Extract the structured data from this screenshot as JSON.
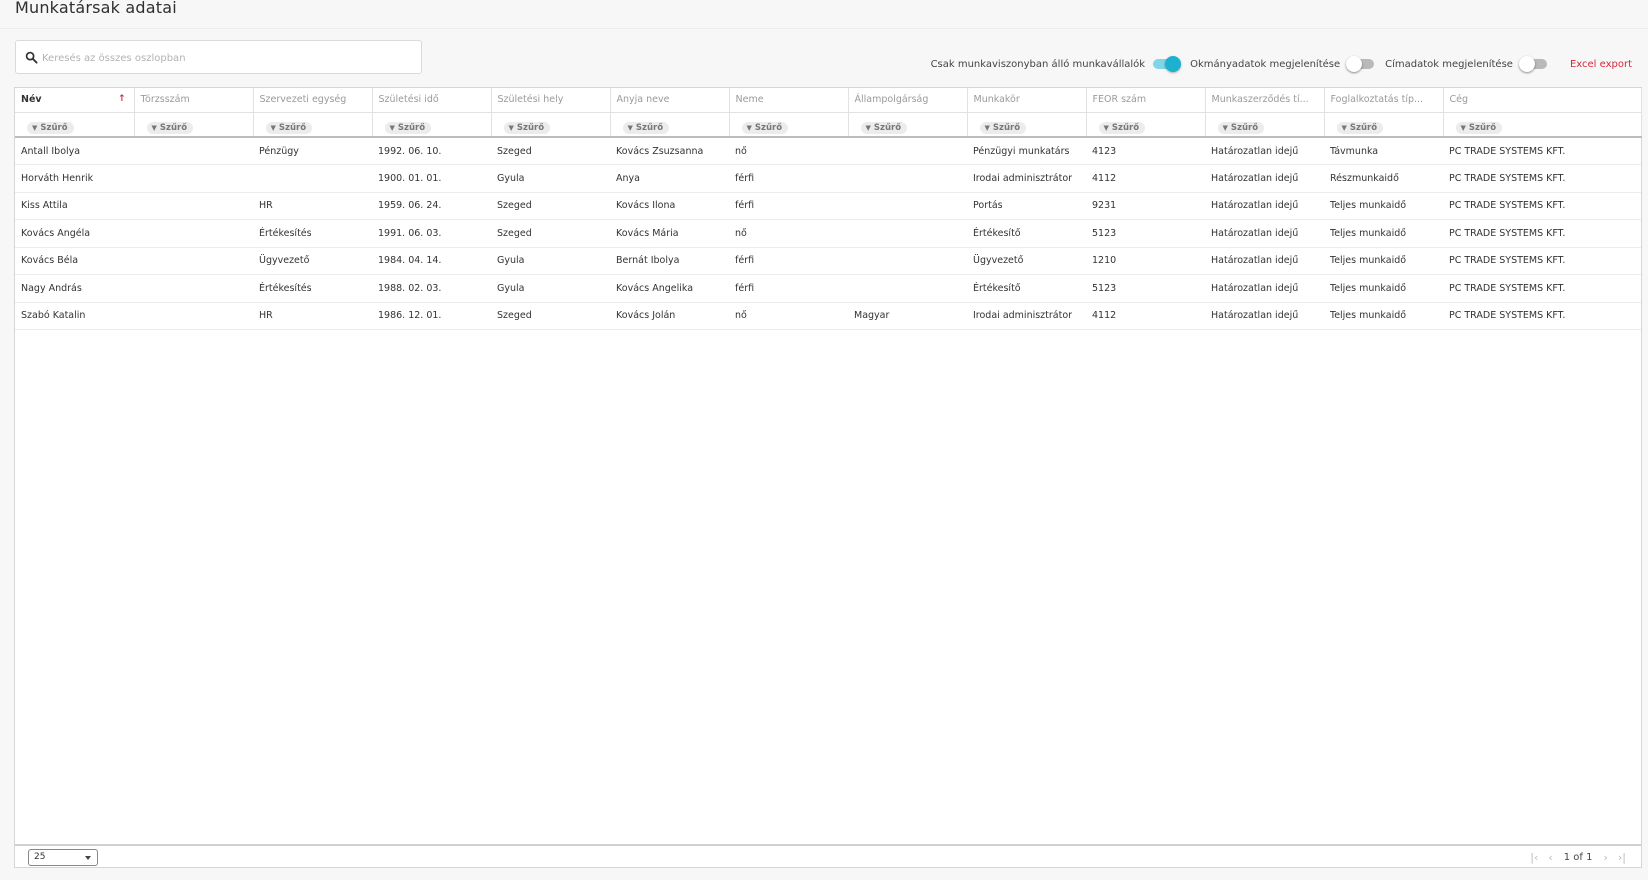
{
  "header": {
    "title": "Munkatársak adatai"
  },
  "search": {
    "placeholder": "Keresés az összes oszlopban",
    "value": ""
  },
  "toggles": [
    {
      "label": "Csak munkaviszonyban álló munkavállalók",
      "on": true
    },
    {
      "label": "Okmányadatok megjelenítése",
      "on": false
    },
    {
      "label": "Címadatok megjelenítése",
      "on": false
    }
  ],
  "excel_export": "Excel export",
  "colors": {
    "accent": "#1bb1cf",
    "link_red": "#d6283c"
  },
  "table": {
    "columns": [
      "Név",
      "Törzsszám",
      "Szervezeti egység",
      "Születési idő",
      "Születési hely",
      "Anyja neve",
      "Neme",
      "Állampolgárság",
      "Munkakör",
      "FEOR szám",
      "Munkaszerződés tí...",
      "Foglalkoztatás típ...",
      "Cég"
    ],
    "sorted_column": "Név",
    "sort_direction": "ascending",
    "filter_label": "Szűrő",
    "rows": [
      [
        "Antall Ibolya",
        "",
        "Pénzügy",
        "1992. 06. 10.",
        "Szeged",
        "Kovács Zsuzsanna",
        "nő",
        "",
        "Pénzügyi munkatárs",
        "4123",
        "Határozatlan idejű",
        "Távmunka",
        "PC TRADE SYSTEMS KFT."
      ],
      [
        "Horváth Henrik",
        "",
        "",
        "1900. 01. 01.",
        "Gyula",
        "Anya",
        "férfi",
        "",
        "Irodai adminisztrátor",
        "4112",
        "Határozatlan idejű",
        "Részmunkaidő",
        "PC TRADE SYSTEMS KFT."
      ],
      [
        "Kiss Attila",
        "",
        "HR",
        "1959. 06. 24.",
        "Szeged",
        "Kovács Ilona",
        "férfi",
        "",
        "Portás",
        "9231",
        "Határozatlan idejű",
        "Teljes munkaidő",
        "PC TRADE SYSTEMS KFT."
      ],
      [
        "Kovács Angéla",
        "",
        "Értékesítés",
        "1991. 06. 03.",
        "Szeged",
        "Kovács Mária",
        "nő",
        "",
        "Értékesítő",
        "5123",
        "Határozatlan idejű",
        "Teljes munkaidő",
        "PC TRADE SYSTEMS KFT."
      ],
      [
        "Kovács Béla",
        "",
        "Ügyvezető",
        "1984. 04. 14.",
        "Gyula",
        "Bernát Ibolya",
        "férfi",
        "",
        "Ügyvezető",
        "1210",
        "Határozatlan idejű",
        "Teljes munkaidő",
        "PC TRADE SYSTEMS KFT."
      ],
      [
        "Nagy András",
        "",
        "Értékesítés",
        "1988. 02. 03.",
        "Gyula",
        "Kovács Angelika",
        "férfi",
        "",
        "Értékesítő",
        "5123",
        "Határozatlan idejű",
        "Teljes munkaidő",
        "PC TRADE SYSTEMS KFT."
      ],
      [
        "Szabó Katalin",
        "",
        "HR",
        "1986. 12. 01.",
        "Szeged",
        "Kovács Jolán",
        "nő",
        "Magyar",
        "Irodai adminisztrátor",
        "4112",
        "Határozatlan idejű",
        "Teljes munkaidő",
        "PC TRADE SYSTEMS KFT."
      ]
    ]
  },
  "footer": {
    "page_size": "25",
    "page_info": "1 of 1",
    "icons": [
      "first-page-icon",
      "previous-page-icon",
      "next-page-icon",
      "last-page-icon"
    ]
  }
}
